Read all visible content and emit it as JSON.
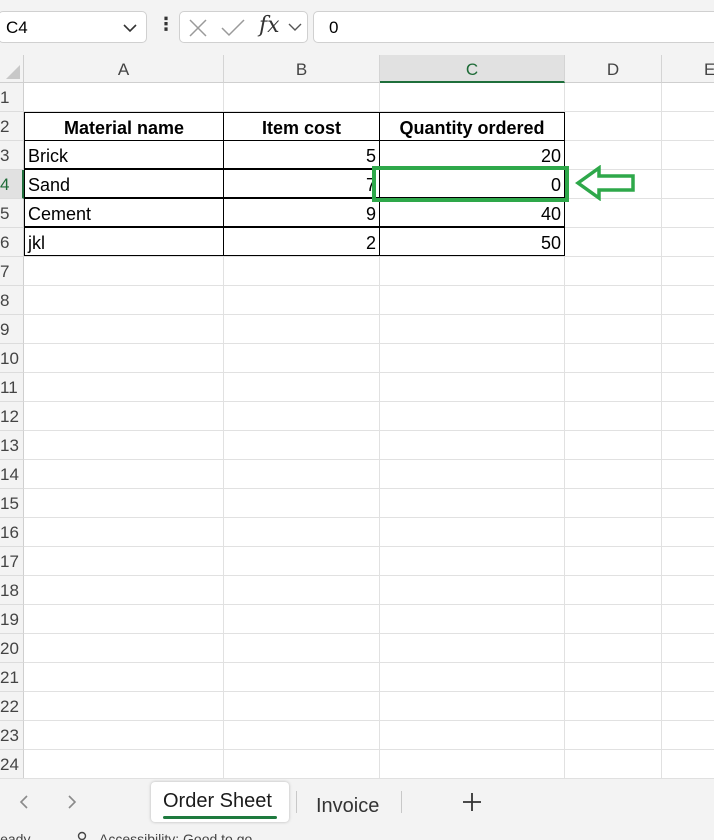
{
  "formula_bar": {
    "name_box": "C4",
    "fx_label": "fx",
    "formula_value": "0"
  },
  "columns": [
    {
      "letter": "A",
      "selected": false
    },
    {
      "letter": "B",
      "selected": false
    },
    {
      "letter": "C",
      "selected": true
    },
    {
      "letter": "D",
      "selected": false
    },
    {
      "letter": "E",
      "selected": false
    }
  ],
  "rows": [
    "1",
    "2",
    "3",
    "4",
    "5",
    "6",
    "7",
    "8",
    "9",
    "10",
    "11",
    "12",
    "13",
    "14",
    "15",
    "16",
    "17",
    "18",
    "19",
    "20",
    "21",
    "22",
    "23",
    "24"
  ],
  "selected_row": "4",
  "table": {
    "headers": [
      "Material name",
      "Item cost",
      "Quantity ordered"
    ],
    "rows": [
      [
        "Brick",
        "5",
        "20"
      ],
      [
        "Sand",
        "7",
        "0"
      ],
      [
        "Cement",
        "9",
        "40"
      ],
      [
        "jkl",
        "2",
        "50"
      ]
    ]
  },
  "annotation": {
    "color": "#2ea84a",
    "target_cell": "C4"
  },
  "sheet_tabs": [
    {
      "label": "Order Sheet",
      "active": true
    },
    {
      "label": "Invoice",
      "active": false
    }
  ],
  "status_bar": {
    "ready": "Ready",
    "accessibility": "Accessibility: Good to go"
  },
  "colors": {
    "accent": "#1e7a3e",
    "annotation": "#2ea84a",
    "chrome_bg": "#f3f3f3"
  }
}
